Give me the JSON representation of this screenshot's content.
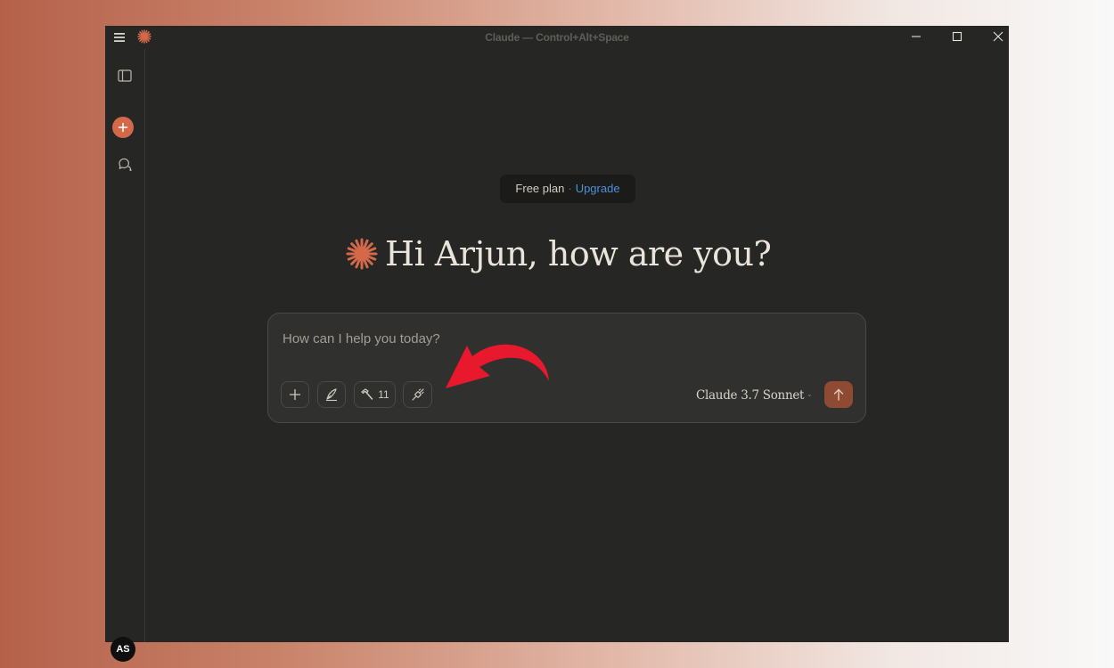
{
  "window": {
    "title": "Claude — Control+Alt+Space"
  },
  "sidebar": {
    "avatar_initials": "AS"
  },
  "plan": {
    "label": "Free plan",
    "separator": "·",
    "upgrade_label": "Upgrade"
  },
  "greeting": {
    "text": "Hi Arjun, how are you?"
  },
  "composer": {
    "placeholder": "How can I help you today?",
    "tools_count": "11",
    "model_label": "Claude 3.7 Sonnet"
  },
  "icons": {
    "menu": "hamburger-menu-icon",
    "logo": "claude-starburst-icon",
    "sidebar_toggle": "sidebar-panel-icon",
    "new_chat": "plus-icon",
    "chats": "chat-bubbles-icon",
    "attach": "plus-icon",
    "style": "pen-nib-icon",
    "tools": "hammer-icon",
    "integrations": "plug-icon",
    "send": "arrow-up-icon",
    "model_dropdown": "chevron-down-icon",
    "annotation": "red-curved-arrow"
  },
  "colors": {
    "accent": "#d4694a",
    "send_button": "#8e4a33",
    "link": "#4f8fd8",
    "window_bg": "#262624",
    "annotation_arrow": "#e8192c"
  }
}
